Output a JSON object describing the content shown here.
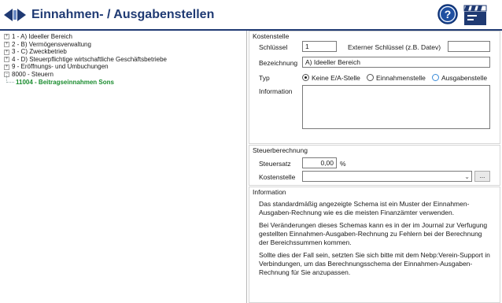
{
  "header": {
    "title": "Einnahmen- / Ausgabenstellen",
    "nav_icon": "back-forward-icon",
    "help_icon": "help-icon",
    "clap_icon": "clapperboard-icon",
    "colors": {
      "title": "#1f3a73",
      "help": "#1f4fa0",
      "active_tree": "#1a8c2e"
    }
  },
  "tree": {
    "items": [
      {
        "label": "1 - A) Ideeller Bereich",
        "expander": "+"
      },
      {
        "label": "2 - B) Vermögensverwaltung",
        "expander": "+"
      },
      {
        "label": "3 - C) Zweckbetrieb",
        "expander": "+"
      },
      {
        "label": "4 - D) Steuerpflichtige wirtschaftliche Geschäftsbetriebe",
        "expander": "+"
      },
      {
        "label": "9 - Eröffnungs- und Umbuchungen",
        "expander": "+"
      },
      {
        "label": "8000 - Steuern",
        "expander": "-"
      },
      {
        "label": "11004 - Beitragseinnahmen Sons",
        "expander": ""
      }
    ]
  },
  "kostenstelle": {
    "group_title": "Kostenstelle",
    "schluessel_label": "Schlüssel",
    "schluessel_value": "1",
    "extern_label": "Externer Schlüssel (z.B. Datev)",
    "extern_value": "",
    "bezeichnung_label": "Bezeichnung",
    "bezeichnung_value": "A) Ideeller Bereich",
    "typ_label": "Typ",
    "typ_options": [
      "Keine E/A-Stelle",
      "Einnahmenstelle",
      "Ausgabenstelle"
    ],
    "typ_selected": "Keine E/A-Stelle",
    "information_label": "Information",
    "information_value": ""
  },
  "steuer": {
    "group_title": "Steuerberechnung",
    "steuersatz_label": "Steuersatz",
    "steuersatz_value": "0,00",
    "percent": "%",
    "kostenstelle_label": "Kostenstelle",
    "kostenstelle_value": "",
    "browse_label": "..."
  },
  "information": {
    "group_title": "Information",
    "paragraphs": [
      "Das standardmäßig angezeigte Schema ist ein Muster der Einnahmen-Ausgaben-Rechnung wie es die meisten Finanzämter verwenden.",
      "Bei Veränderungen dieses Schemas kann es in der im Journal zur Verfugung gestellten Einnahmen-Ausgaben-Rechnung zu Fehlern bei der Berechnung der Bereichssummen kommen.",
      "Sollte dies der Fall sein, setzten Sie sich bitte mit dem Nebp:Verein-Support in Verbindungen, um das Berechnungsschema der Einnahmen-Ausgaben-Rechnung für Sie anzupassen."
    ]
  }
}
